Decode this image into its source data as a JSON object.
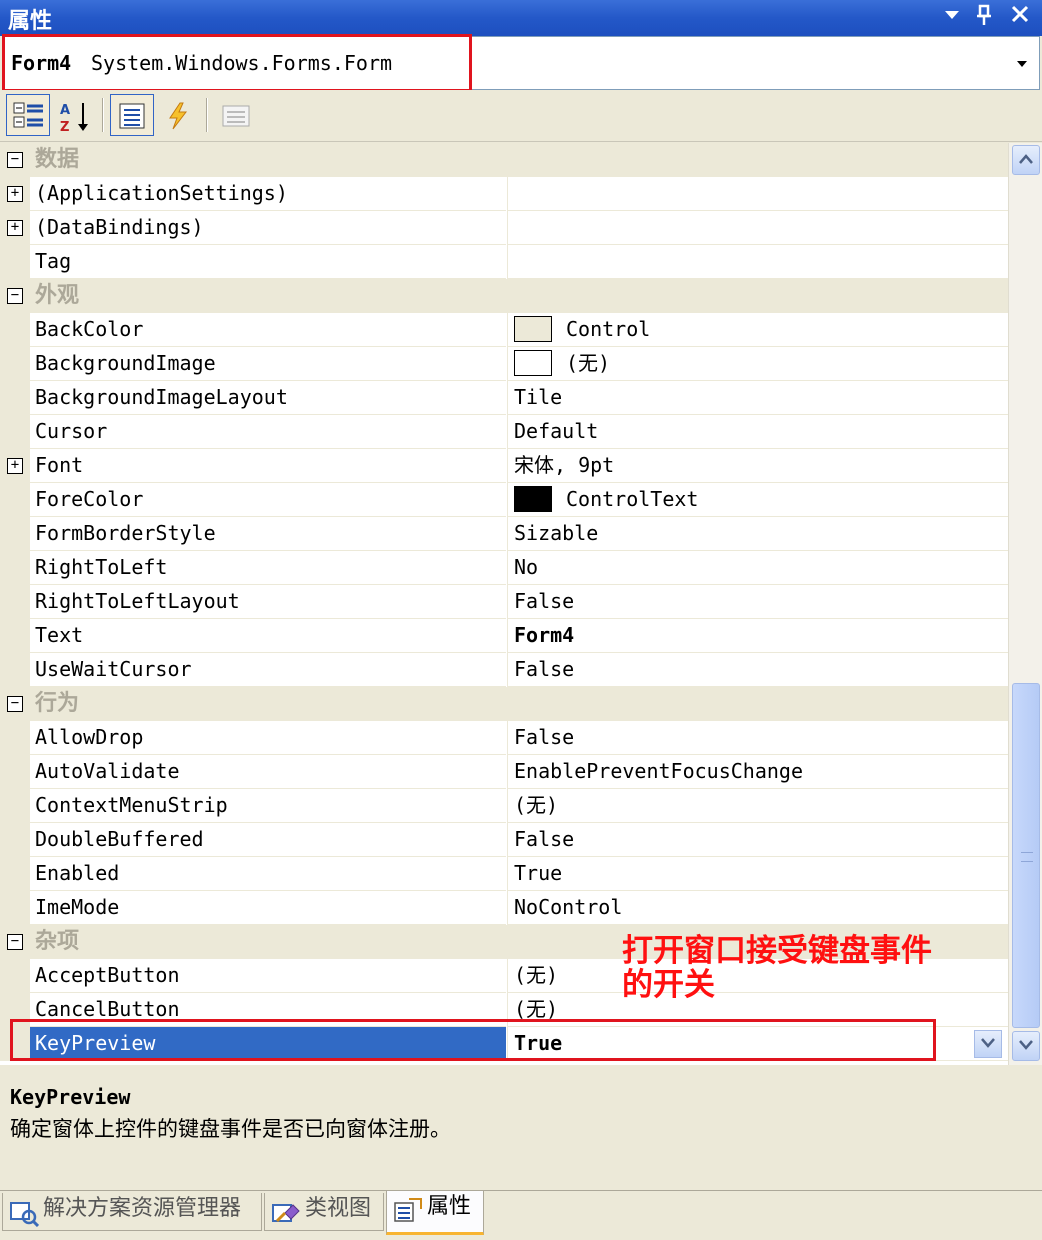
{
  "window": {
    "title": "属性",
    "pin_icon": "pin-icon",
    "close_icon": "close-icon",
    "menu_icon": "dropdown-arrow-icon"
  },
  "object_selector": {
    "name": "Form4",
    "type": "System.Windows.Forms.Form"
  },
  "toolbar": {
    "buttons": [
      "categorized-icon",
      "alphabetical-icon",
      "properties-icon",
      "events-icon",
      "property-pages-icon"
    ]
  },
  "grid": {
    "rows": [
      {
        "kind": "category",
        "label": "数据"
      },
      {
        "kind": "prop",
        "name": "(ApplicationSettings)",
        "value": "",
        "expandable": true
      },
      {
        "kind": "prop",
        "name": "(DataBindings)",
        "value": "",
        "expandable": true
      },
      {
        "kind": "prop",
        "name": "Tag",
        "value": ""
      },
      {
        "kind": "category",
        "label": "外观"
      },
      {
        "kind": "prop",
        "name": "BackColor",
        "value": "Control",
        "swatch": "#ece9d8"
      },
      {
        "kind": "prop",
        "name": "BackgroundImage",
        "value": "(无)",
        "swatch": "#ffffff"
      },
      {
        "kind": "prop",
        "name": "BackgroundImageLayout",
        "value": "Tile"
      },
      {
        "kind": "prop",
        "name": "Cursor",
        "value": "Default"
      },
      {
        "kind": "prop",
        "name": "Font",
        "value": "宋体, 9pt",
        "expandable": true
      },
      {
        "kind": "prop",
        "name": "ForeColor",
        "value": "ControlText",
        "swatch": "#000000"
      },
      {
        "kind": "prop",
        "name": "FormBorderStyle",
        "value": "Sizable"
      },
      {
        "kind": "prop",
        "name": "RightToLeft",
        "value": "No"
      },
      {
        "kind": "prop",
        "name": "RightToLeftLayout",
        "value": "False"
      },
      {
        "kind": "prop",
        "name": "Text",
        "value": "Form4",
        "bold": true
      },
      {
        "kind": "prop",
        "name": "UseWaitCursor",
        "value": "False"
      },
      {
        "kind": "category",
        "label": "行为"
      },
      {
        "kind": "prop",
        "name": "AllowDrop",
        "value": "False"
      },
      {
        "kind": "prop",
        "name": "AutoValidate",
        "value": "EnablePreventFocusChange"
      },
      {
        "kind": "prop",
        "name": "ContextMenuStrip",
        "value": "(无)"
      },
      {
        "kind": "prop",
        "name": "DoubleBuffered",
        "value": "False"
      },
      {
        "kind": "prop",
        "name": "Enabled",
        "value": "True"
      },
      {
        "kind": "prop",
        "name": "ImeMode",
        "value": "NoControl"
      },
      {
        "kind": "category",
        "label": "杂项"
      },
      {
        "kind": "prop",
        "name": "AcceptButton",
        "value": "(无)"
      },
      {
        "kind": "prop",
        "name": "CancelButton",
        "value": "(无)"
      },
      {
        "kind": "prop",
        "name": "KeyPreview",
        "value": "True",
        "bold": true,
        "selected": true
      }
    ]
  },
  "description": {
    "name": "KeyPreview",
    "text": "确定窗体上控件的键盘事件是否已向窗体注册。"
  },
  "annotation": {
    "text": "打开窗口接受键盘事件的开关",
    "color": "#ff1010"
  },
  "tabs": [
    {
      "label": "解决方案资源管理器",
      "icon": "solution-explorer-icon",
      "active": false
    },
    {
      "label": "类视图",
      "icon": "class-view-icon",
      "active": false
    },
    {
      "label": "属性",
      "icon": "properties-window-icon",
      "active": true
    }
  ],
  "colors": {
    "selection": "#316ac5",
    "highlight_box": "#e0141e",
    "title_bar": "#2458c8"
  }
}
